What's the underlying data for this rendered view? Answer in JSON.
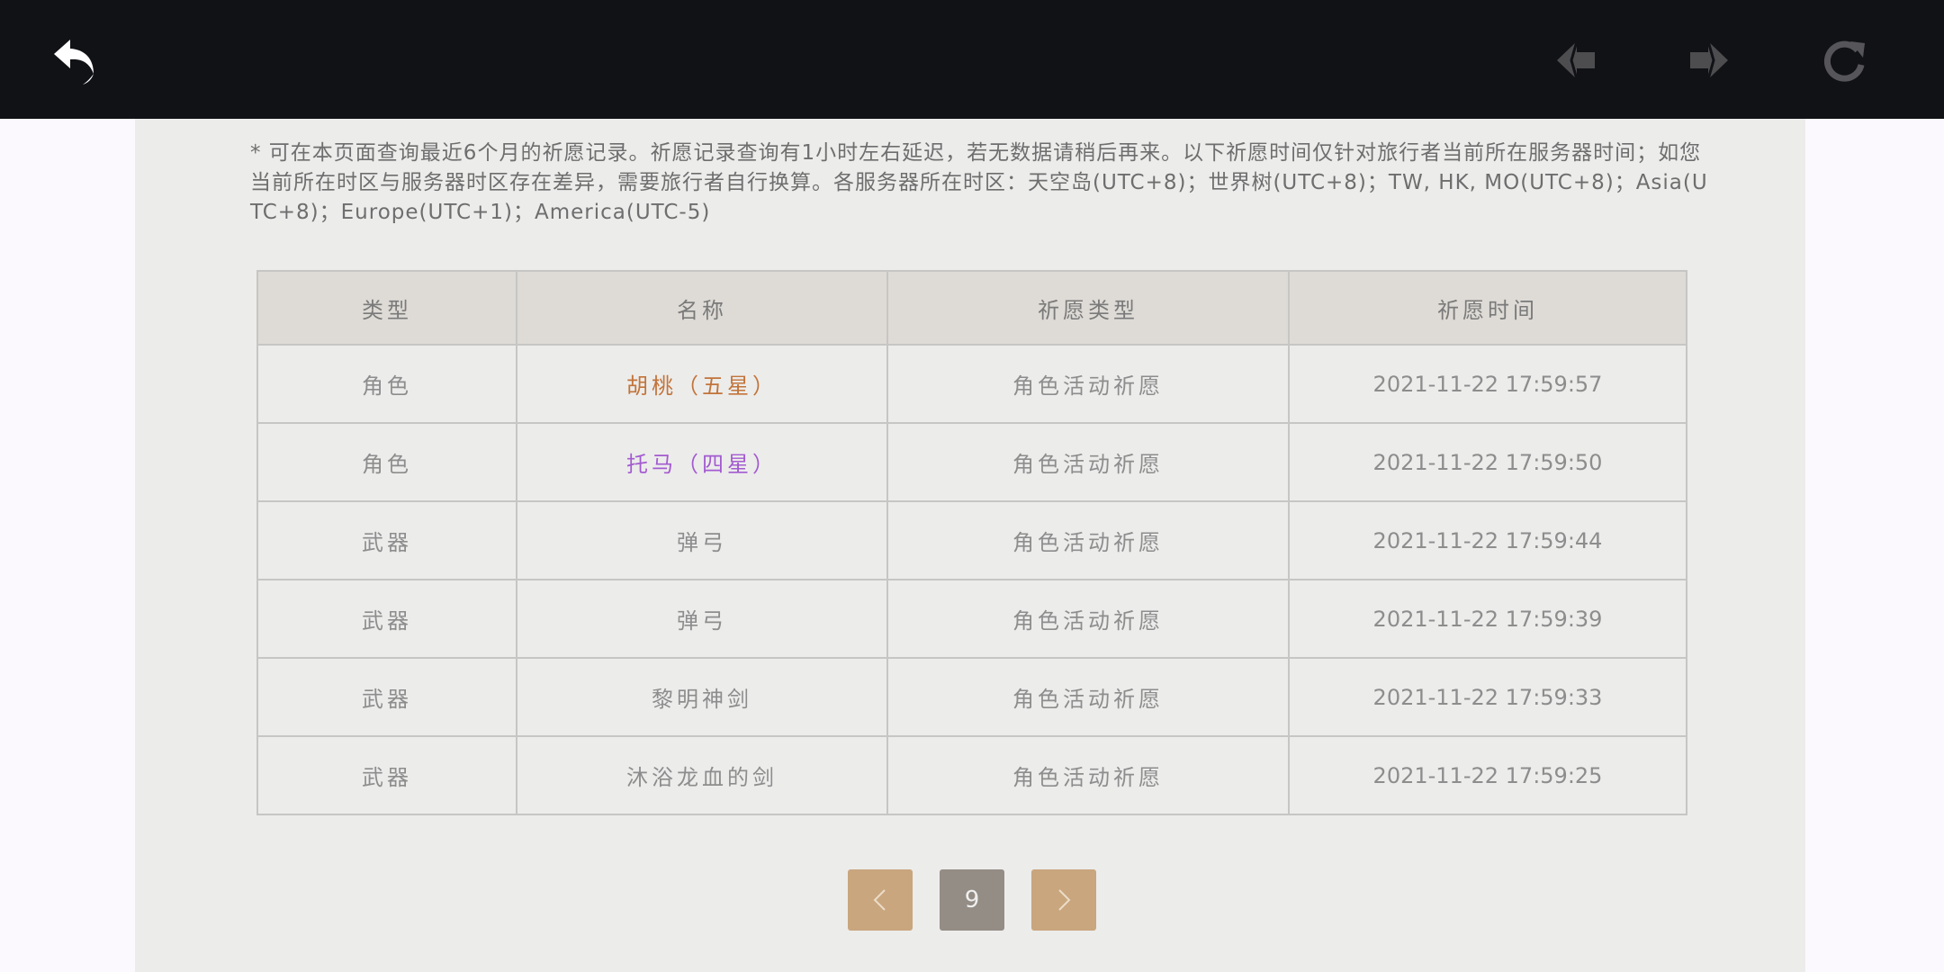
{
  "topbar": {
    "back_icon": "back-arrow-icon",
    "prev_icon": "nav-back-icon",
    "forward_icon": "nav-forward-icon",
    "refresh_icon": "refresh-icon"
  },
  "notice": "* 可在本页面查询最近6个月的祈愿记录。祈愿记录查询有1小时左右延迟，若无数据请稍后再来。以下祈愿时间仅针对旅行者当前所在服务器时间；如您当前所在时区与服务器时区存在差异，需要旅行者自行换算。各服务器所在时区：天空岛(UTC+8)；世界树(UTC+8)；TW, HK, MO(UTC+8)；Asia(UTC+8)；Europe(UTC+1)；America(UTC-5)",
  "table": {
    "headers": [
      "类型",
      "名称",
      "祈愿类型",
      "祈愿时间"
    ],
    "rows": [
      {
        "type": "角色",
        "name": "胡桃（五星）",
        "wish_type": "角色活动祈愿",
        "time": "2021-11-22 17:59:57"
      },
      {
        "type": "角色",
        "name": "托马（四星）",
        "wish_type": "角色活动祈愿",
        "time": "2021-11-22 17:59:50"
      },
      {
        "type": "武器",
        "name": "弹弓",
        "wish_type": "角色活动祈愿",
        "time": "2021-11-22 17:59:44"
      },
      {
        "type": "武器",
        "name": "弹弓",
        "wish_type": "角色活动祈愿",
        "time": "2021-11-22 17:59:39"
      },
      {
        "type": "武器",
        "name": "黎明神剑",
        "wish_type": "角色活动祈愿",
        "time": "2021-11-22 17:59:33"
      },
      {
        "type": "武器",
        "name": "沐浴龙血的剑",
        "wish_type": "角色活动祈愿",
        "time": "2021-11-22 17:59:25"
      }
    ]
  },
  "pagination": {
    "current_page": "9",
    "prev_icon": "chevron-left-icon",
    "next_icon": "chevron-right-icon"
  },
  "colors": {
    "five_star": "#c2743a",
    "four_star": "#a35bd0",
    "default_text": "#8d8d8d"
  }
}
